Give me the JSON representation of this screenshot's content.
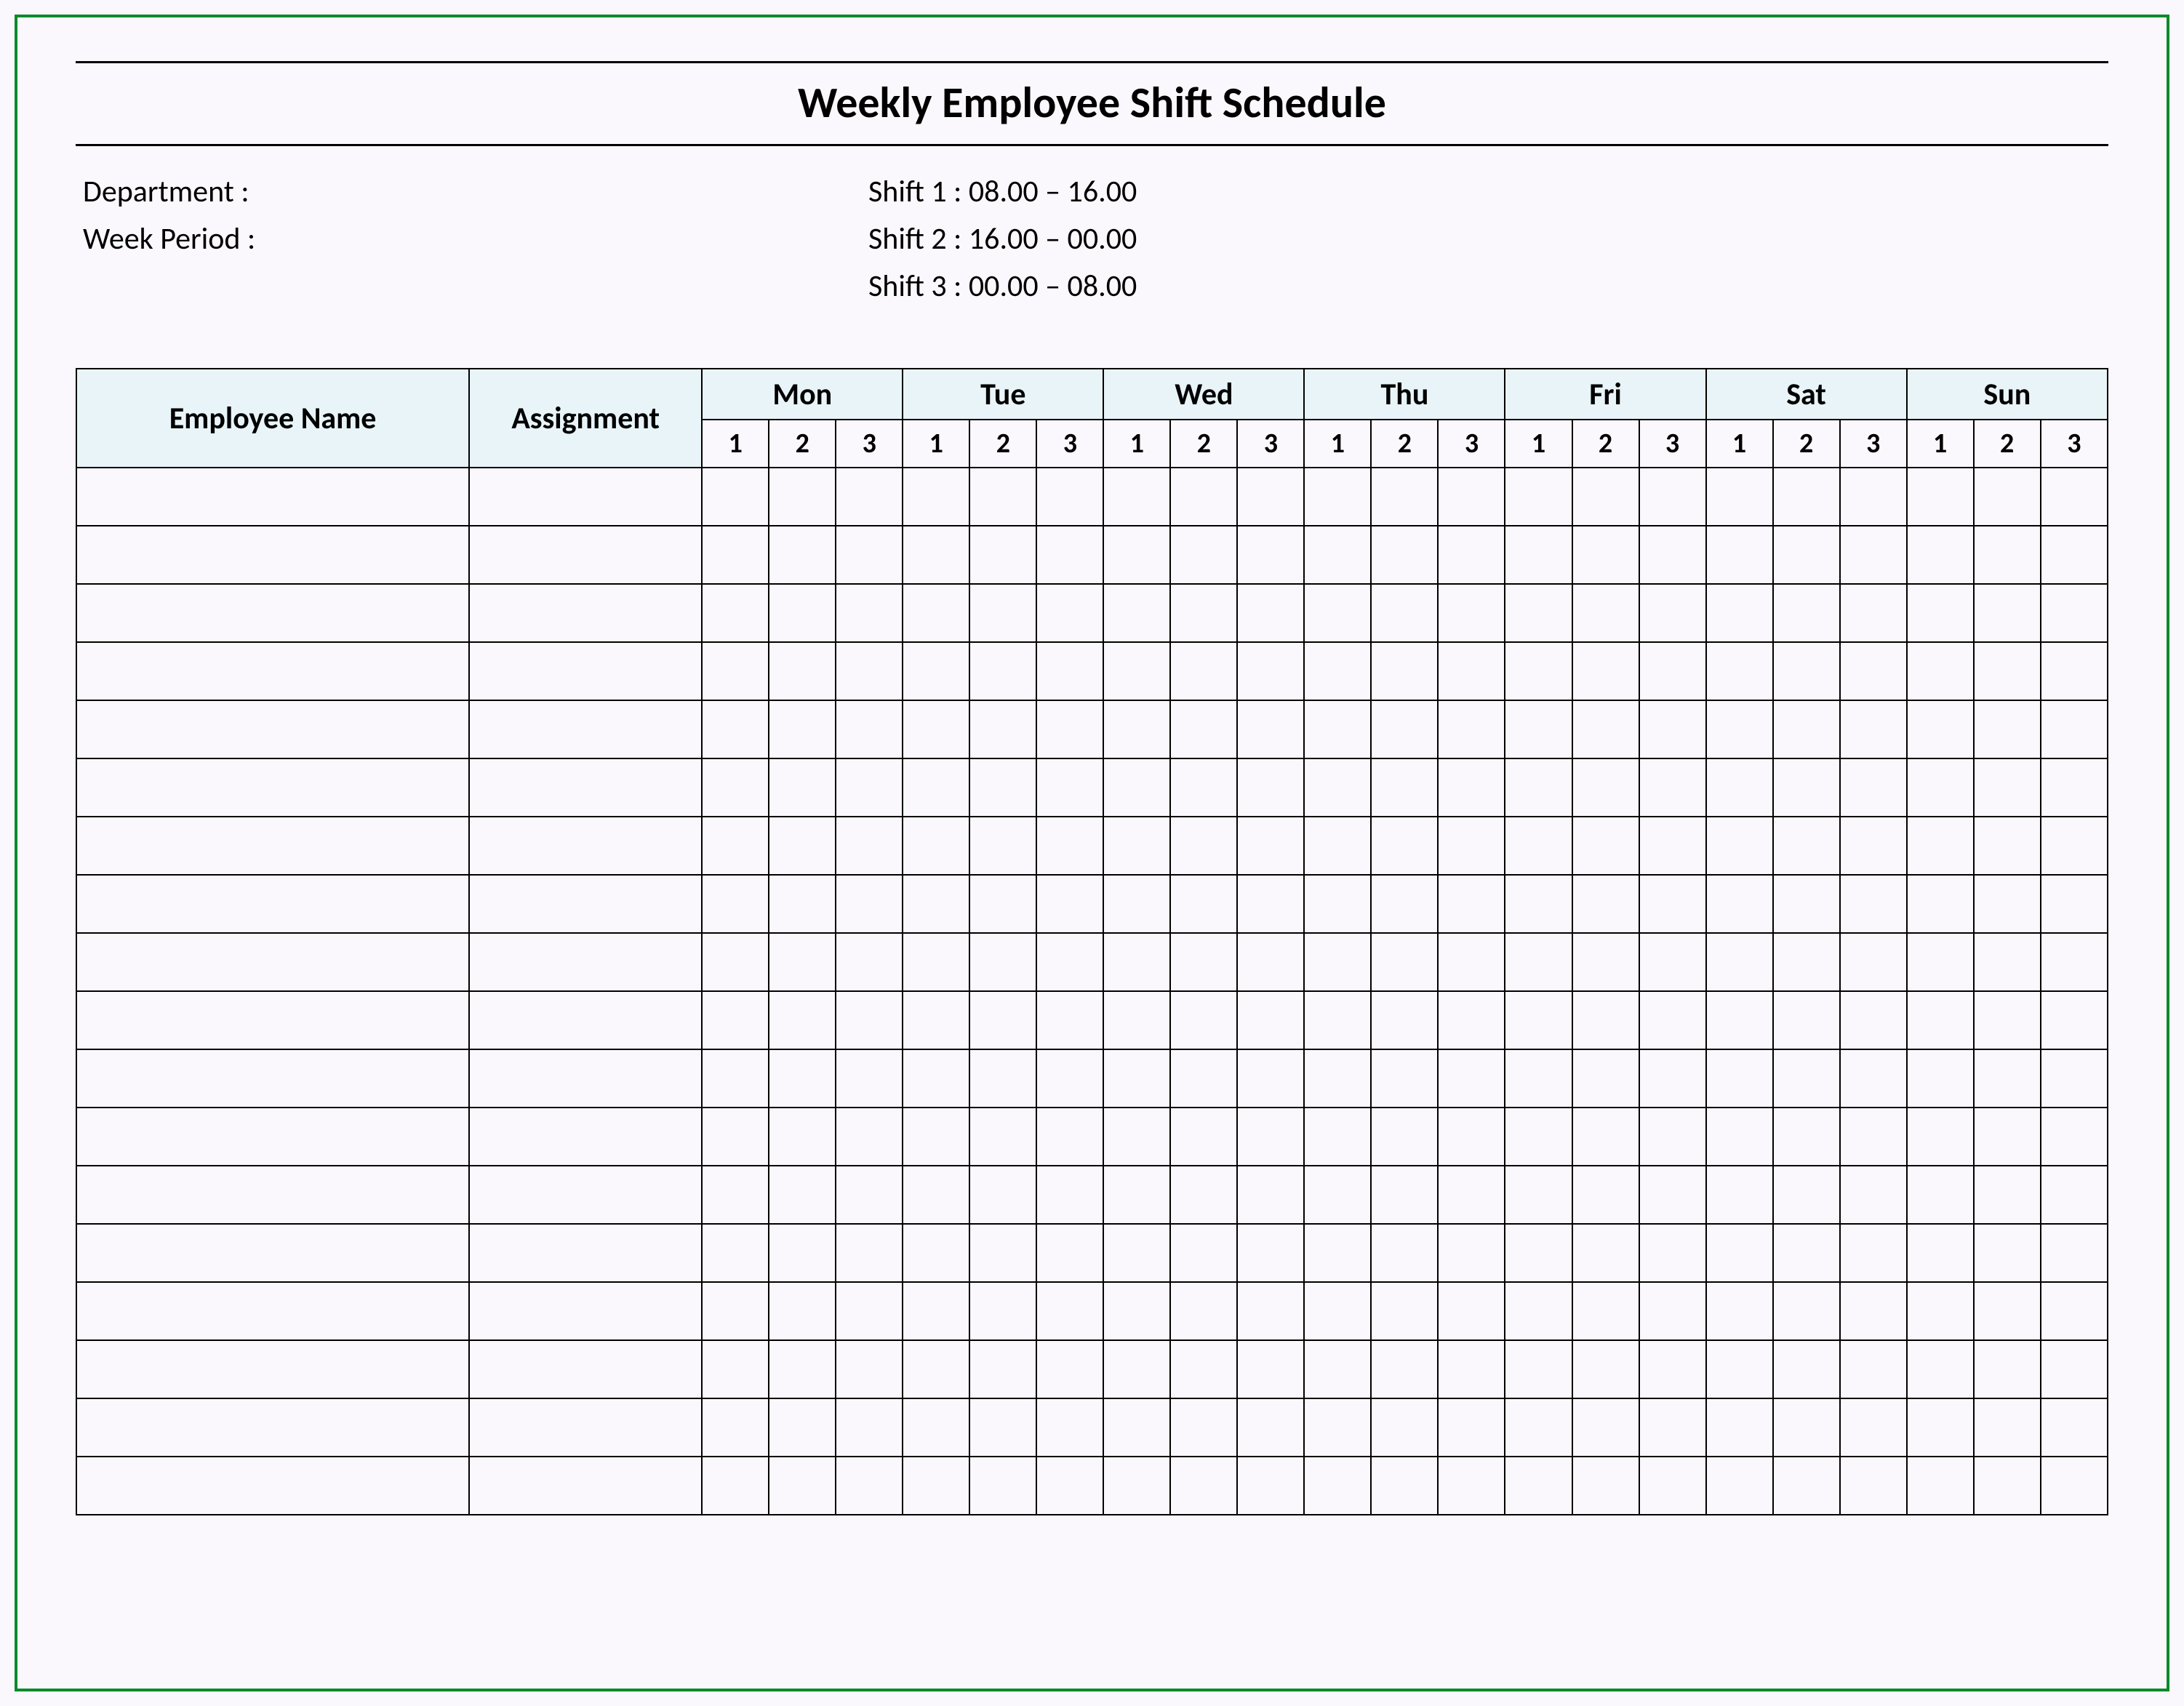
{
  "title": "Weekly Employee Shift Schedule",
  "meta": {
    "department_label": "Department    :",
    "week_period_label": "Week  Period :",
    "shift1": "Shift 1  : 08.00  – 16.00",
    "shift2": "Shift 2  : 16.00  – 00.00",
    "shift3": "Shift 3  : 00.00  – 08.00"
  },
  "table": {
    "employee_header": "Employee Name",
    "assignment_header": "Assignment",
    "days": [
      "Mon",
      "Tue",
      "Wed",
      "Thu",
      "Fri",
      "Sat",
      "Sun"
    ],
    "shift_numbers": [
      "1",
      "2",
      "3"
    ],
    "row_count": 18
  },
  "chart_data": {
    "type": "table",
    "title": "Weekly Employee Shift Schedule",
    "columns": [
      "Employee Name",
      "Assignment",
      "Mon 1",
      "Mon 2",
      "Mon 3",
      "Tue 1",
      "Tue 2",
      "Tue 3",
      "Wed 1",
      "Wed 2",
      "Wed 3",
      "Thu 1",
      "Thu 2",
      "Thu 3",
      "Fri 1",
      "Fri 2",
      "Fri 3",
      "Sat 1",
      "Sat 2",
      "Sat 3",
      "Sun 1",
      "Sun 2",
      "Sun 3"
    ],
    "rows": [],
    "row_count": 18,
    "shifts": {
      "1": "08.00 – 16.00",
      "2": "16.00 – 00.00",
      "3": "00.00 – 08.00"
    }
  }
}
